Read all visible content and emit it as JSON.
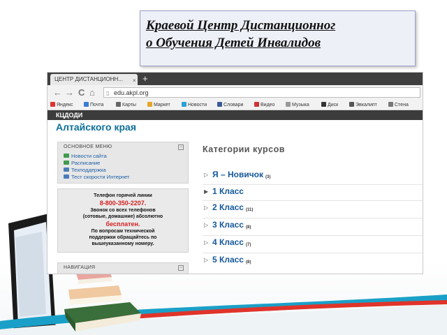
{
  "title": "Краевой Центр Дистанционног\n   о Обучения Детей Инвалидов ",
  "browser": {
    "tab_title": "ЦЕНТР ДИСТАНЦИОНН...",
    "tab_close": "×",
    "new_tab": "+",
    "back": "←",
    "forward": "→",
    "reload": "C",
    "home": "⌂",
    "url": "edu.akpl.org",
    "bookmarks": [
      "Яндекс",
      "Почта",
      "Карты",
      "Маркет",
      "Новости",
      "Словари",
      "Видео",
      "Музыка",
      "Диск",
      "Эвкалипт",
      "Стена"
    ]
  },
  "site": {
    "header": "КЦДОДИ",
    "subtitle": "Алтайского края"
  },
  "main_menu": {
    "title": "ОСНОВНОЕ МЕНЮ",
    "toggle": "−",
    "items": [
      "Новости сайта",
      "Расписание",
      "Техподдержка",
      "Тест скорости Интернет"
    ]
  },
  "hotline": {
    "line1": "Телефон горячей линии",
    "phone": "8-800-350-2207.",
    "line3": "Звонок со всех телефонов",
    "line4": "(сотовые, домашние) абсолютно",
    "free": "бесплатен.",
    "line6": "По вопросам технической",
    "line7": "поддержки обращайтесь по",
    "line8": "вышеуказанному номеру."
  },
  "navigation": {
    "title": "НАВИГАЦИЯ",
    "toggle": "−"
  },
  "categories": {
    "title": "Категории курсов",
    "items": [
      {
        "arrow": "▷",
        "name": "Я – Новичок",
        "count": "(3)"
      },
      {
        "arrow": "▶",
        "name": "1 Класс",
        "count": ""
      },
      {
        "arrow": "▷",
        "name": "2 Класс",
        "count": "(11)"
      },
      {
        "arrow": "▷",
        "name": "3 Класс",
        "count": "(8)"
      },
      {
        "arrow": "▷",
        "name": "4 Класс",
        "count": "(7)"
      },
      {
        "arrow": "▷",
        "name": "5 Класс",
        "count": "(8)"
      }
    ]
  },
  "colors": {
    "link": "#16589a",
    "subtitle": "#0e6f99",
    "hotline_red": "#d42020",
    "swoosh_blue": "#1aa0c8",
    "swoosh_red": "#e0342a"
  }
}
